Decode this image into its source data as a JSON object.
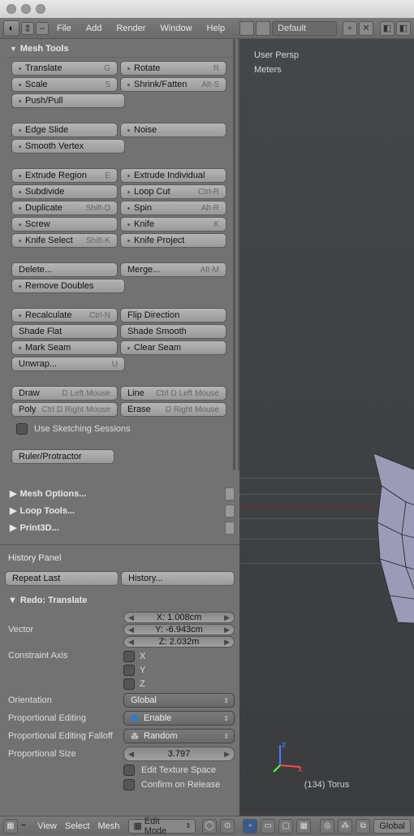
{
  "title_buttons": [
    "close",
    "min",
    "zoom"
  ],
  "topmenu": {
    "items": [
      "File",
      "Add",
      "Render",
      "Window",
      "Help"
    ],
    "layout": "Default"
  },
  "mesh_tools": {
    "header": "Mesh Tools",
    "transform": [
      {
        "label": "Translate",
        "sc": "G"
      },
      {
        "label": "Rotate",
        "sc": "R"
      },
      {
        "label": "Scale",
        "sc": "S"
      },
      {
        "label": "Shrink/Fatten",
        "sc": "Alt-S"
      },
      {
        "label": "Push/Pull",
        "sc": ""
      },
      null
    ],
    "deform": [
      {
        "label": "Edge Slide"
      },
      {
        "label": "Noise"
      },
      {
        "label": "Smooth Vertex"
      },
      null
    ],
    "add": [
      {
        "label": "Extrude Region",
        "sc": "E"
      },
      {
        "label": "Extrude Individual"
      },
      {
        "label": "Subdivide"
      },
      {
        "label": "Loop Cut",
        "sc": "Ctrl-R"
      },
      {
        "label": "Duplicate",
        "sc": "Shift-D"
      },
      {
        "label": "Spin",
        "sc": "Alt-R"
      },
      {
        "label": "Screw"
      },
      {
        "label": "Knife",
        "sc": "K"
      },
      {
        "label": "Knife Select",
        "sc": "Shift-K"
      },
      {
        "label": "Knife Project"
      }
    ],
    "remove": [
      {
        "label": "Delete..."
      },
      {
        "label": "Merge...",
        "sc": "Alt-M",
        "nodot": true
      },
      {
        "label": "Remove Doubles"
      },
      null
    ],
    "normals": [
      {
        "label": "Recalculate",
        "sc": "Ctrl-N"
      },
      {
        "label": "Flip Direction",
        "nodot": true
      },
      {
        "label": "Shade  Flat",
        "nodot": true
      },
      {
        "label": "Shade Smooth",
        "nodot": true
      },
      {
        "label": "Mark Seam"
      },
      {
        "label": "Clear Seam"
      },
      {
        "label": "Unwrap...",
        "sc": "U",
        "nodot": true
      },
      null
    ],
    "sketch": [
      {
        "label": "Draw",
        "sc": "D Left Mouse",
        "nodot": true
      },
      {
        "label": "Line",
        "sc": "Ctrl D Left Mouse",
        "nodot": true
      },
      {
        "label": "Poly",
        "sc": "Ctrl D Right Mouse",
        "nodot": true
      },
      {
        "label": "Erase",
        "sc": "D Right Mouse",
        "nodot": true
      }
    ],
    "sketch_sessions": "Use Sketching Sessions",
    "ruler": "Ruler/Protractor"
  },
  "collapsed": {
    "mesh_options": "Mesh Options...",
    "loop_tools": "Loop Tools...",
    "print3d": "Print3D..."
  },
  "history": {
    "title": "History Panel",
    "repeat": "Repeat Last",
    "hist": "History..."
  },
  "redo_op": {
    "title": "Redo: Translate",
    "vector_label": "Vector",
    "x": "X: 1.008cm",
    "y": "Y: -6.943cm",
    "z": "Z: 2.032m",
    "constraint_label": "Constraint Axis",
    "cx": "X",
    "cy": "Y",
    "cz": "Z",
    "orientation_label": "Orientation",
    "orientation": "Global",
    "prop_editing_label": "Proportional Editing",
    "prop_editing": "Enable",
    "falloff_label": "Proportional Editing Falloff",
    "falloff": "Random",
    "size_label": "Proportional Size",
    "size": "3.797",
    "etx": "Edit Texture Space",
    "cor": "Confirm on Release"
  },
  "viewport": {
    "persp": "User Persp",
    "units": "Meters",
    "obj": "(134) Torus"
  },
  "header_left": {
    "menus": [
      "View",
      "Select",
      "Mesh"
    ]
  },
  "header_right": {
    "mode": "Edit Mode",
    "orient": "Global"
  }
}
